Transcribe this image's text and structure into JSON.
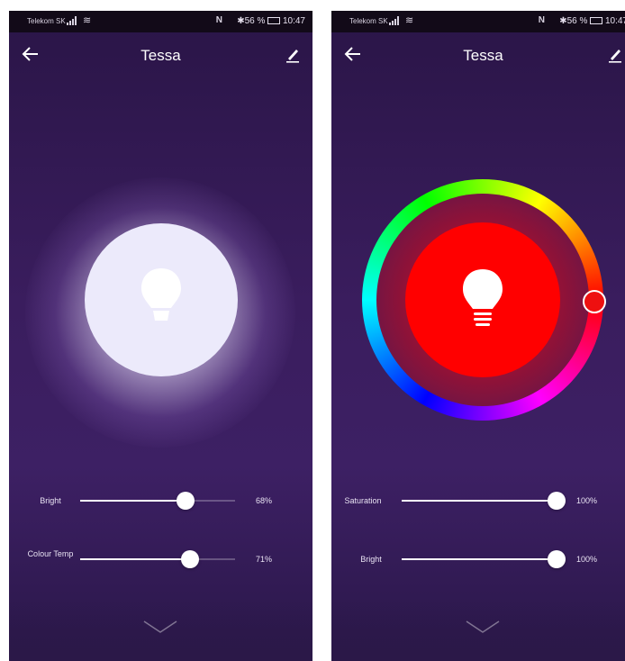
{
  "status": {
    "carrier": "Telekom SK",
    "nfc": "N",
    "bluetooth": "✱",
    "battery_text": "56 %",
    "time": "10:47"
  },
  "left": {
    "title": "Tessa",
    "bright_label": "Bright",
    "bright_value": "68%",
    "bright_level": 0.68,
    "temp_label": "Colour Temp",
    "temp_value": "71%",
    "temp_level": 0.71
  },
  "right": {
    "title": "Tessa",
    "saturation_label": "Saturation",
    "saturation_value": "100%",
    "saturation_level": 1.0,
    "bright_label": "Bright",
    "bright_value": "100%",
    "bright_level": 1.0,
    "selected_color": "#ff0000"
  },
  "icons": {
    "back": "back-arrow-icon",
    "edit": "edit-pencil-icon",
    "bulb": "light-bulb-icon",
    "chevron": "chevron-down-icon"
  }
}
